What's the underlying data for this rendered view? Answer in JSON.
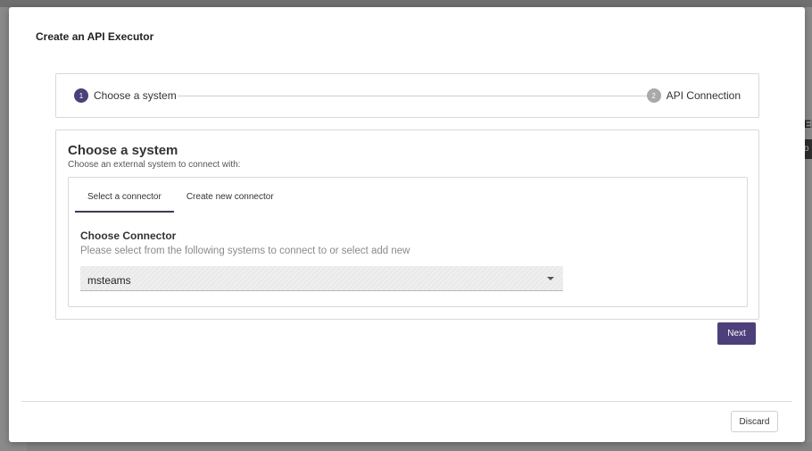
{
  "background": {
    "right_header_text": "EN",
    "right_cell_text": "o"
  },
  "modal": {
    "title": "Create an API Executor"
  },
  "stepper": {
    "steps": [
      {
        "number": "1",
        "label": "Choose a system",
        "state": "active"
      },
      {
        "number": "2",
        "label": "API Connection",
        "state": "inactive"
      }
    ]
  },
  "section": {
    "title": "Choose a system",
    "subtitle": "Choose an external system to connect with:"
  },
  "tabs": [
    {
      "label": "Select a connector",
      "active": true
    },
    {
      "label": "Create new connector",
      "active": false
    }
  ],
  "connector": {
    "title": "Choose Connector",
    "subtitle": "Please select from the following systems to connect to or select add new",
    "selected_value": "msteams"
  },
  "actions": {
    "next_label": "Next",
    "discard_label": "Discard"
  },
  "colors": {
    "accent": "#4d3f7a",
    "inactive_step": "#a9a9a9",
    "overlay": "#8a8a8a"
  }
}
